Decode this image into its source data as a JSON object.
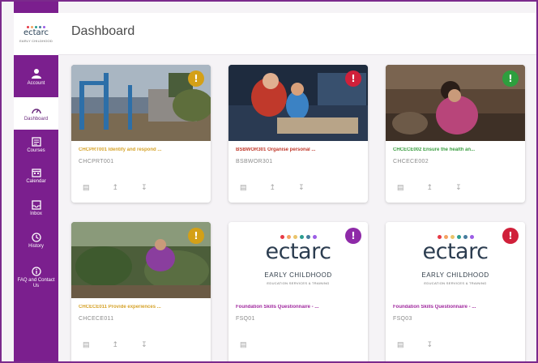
{
  "brand": {
    "logo_text": "ectarc",
    "logo_sub": "EARLY CHILDHOOD"
  },
  "header": {
    "title": "Dashboard"
  },
  "sidebar": {
    "items": [
      {
        "label": "Account",
        "icon": "account-icon",
        "active": false
      },
      {
        "label": "Dashboard",
        "icon": "dashboard-icon",
        "active": true
      },
      {
        "label": "Courses",
        "icon": "courses-icon",
        "active": false
      },
      {
        "label": "Calendar",
        "icon": "calendar-icon",
        "active": false
      },
      {
        "label": "Inbox",
        "icon": "inbox-icon",
        "active": false
      },
      {
        "label": "History",
        "icon": "history-icon",
        "active": false
      },
      {
        "label": "FAQ and Contact Us",
        "icon": "info-icon",
        "active": false
      }
    ]
  },
  "colors": {
    "primary": "#7b1f8e",
    "badge_yellow": "#d4a017",
    "badge_red": "#d0203a",
    "badge_green": "#2e9f3e",
    "badge_purple": "#8e2aa8",
    "title_orange": "#d6a32a",
    "title_red": "#c0392b",
    "title_green": "#3a9d40",
    "title_magenta": "#a0289e"
  },
  "cards": [
    {
      "title": "CHCPRT001 Identify and respond ...",
      "code": "CHCPRT001",
      "badge": "!",
      "badge_color": "#d4a017",
      "title_color": "#d6a32a",
      "image": "playground-photo"
    },
    {
      "title": "BSBWOR301 Organise personal ...",
      "code": "BSBWOR301",
      "badge": "!",
      "badge_color": "#d0203a",
      "title_color": "#c0392b",
      "image": "classroom-photo"
    },
    {
      "title": "CHCECE002 Ensure the health an...",
      "code": "CHCECE002",
      "badge": "!",
      "badge_color": "#2e9f3e",
      "title_color": "#3a9d40",
      "image": "child-playing-photo"
    },
    {
      "title": "CHCECE011 Provide experiences ...",
      "code": "CHCECE011",
      "badge": "!",
      "badge_color": "#d4a017",
      "title_color": "#d6a32a",
      "image": "garden-photo"
    },
    {
      "title": "Foundation Skills Questionnaire - ...",
      "code": "FSQ01",
      "badge": "!",
      "badge_color": "#8e2aa8",
      "title_color": "#a0289e",
      "image": "ectarc-logo"
    },
    {
      "title": "Foundation Skills Questionnaire - ...",
      "code": "FSQ03",
      "badge": "!",
      "badge_color": "#d0203a",
      "title_color": "#a0289e",
      "image": "ectarc-logo"
    }
  ],
  "ectarc_logo": {
    "word": "ectarc",
    "line1": "EARLY CHILDHOOD",
    "line2": "EDUCATION SERVICES & TRAINING"
  }
}
